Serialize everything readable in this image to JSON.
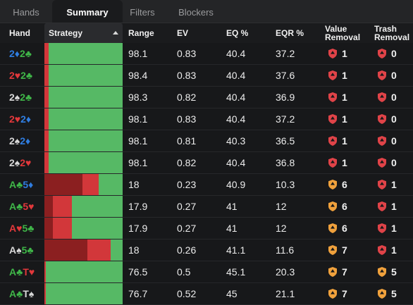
{
  "tabs": [
    "Hands",
    "Summary",
    "Filters",
    "Blockers"
  ],
  "active_tab": "Summary",
  "columns": {
    "hand": "Hand",
    "strategy": "Strategy",
    "range": "Range",
    "ev": "EV",
    "eq": "EQ %",
    "eqr": "EQR %",
    "value_removal": [
      "Value",
      "Removal"
    ],
    "trash_removal": [
      "Trash",
      "Removal"
    ]
  },
  "colors": {
    "dark_red": "#8b1f20",
    "red": "#d2373a",
    "green": "#56b965",
    "badge_red": "#e04348",
    "badge_orange": "#f0a13c"
  },
  "rows": [
    {
      "cards": [
        [
          "2",
          "diamond"
        ],
        [
          "2",
          "club"
        ]
      ],
      "strategy": [
        [
          "red",
          5
        ],
        [
          "green",
          95
        ]
      ],
      "range": "98.1",
      "ev": "0.83",
      "eq": "40.4",
      "eqr": "37.2",
      "value": "1",
      "value_badge": "red",
      "trash": "0",
      "trash_badge": "red"
    },
    {
      "cards": [
        [
          "2",
          "heart"
        ],
        [
          "2",
          "club"
        ]
      ],
      "strategy": [
        [
          "red",
          5
        ],
        [
          "green",
          95
        ]
      ],
      "range": "98.4",
      "ev": "0.83",
      "eq": "40.4",
      "eqr": "37.6",
      "value": "1",
      "value_badge": "red",
      "trash": "0",
      "trash_badge": "red"
    },
    {
      "cards": [
        [
          "2",
          "spade"
        ],
        [
          "2",
          "club"
        ]
      ],
      "strategy": [
        [
          "red",
          5
        ],
        [
          "green",
          95
        ]
      ],
      "range": "98.3",
      "ev": "0.82",
      "eq": "40.4",
      "eqr": "36.9",
      "value": "1",
      "value_badge": "red",
      "trash": "0",
      "trash_badge": "red"
    },
    {
      "cards": [
        [
          "2",
          "heart"
        ],
        [
          "2",
          "diamond"
        ]
      ],
      "strategy": [
        [
          "red",
          5
        ],
        [
          "green",
          95
        ]
      ],
      "range": "98.1",
      "ev": "0.83",
      "eq": "40.4",
      "eqr": "37.2",
      "value": "1",
      "value_badge": "red",
      "trash": "0",
      "trash_badge": "red"
    },
    {
      "cards": [
        [
          "2",
          "spade"
        ],
        [
          "2",
          "diamond"
        ]
      ],
      "strategy": [
        [
          "red",
          5
        ],
        [
          "green",
          95
        ]
      ],
      "range": "98.1",
      "ev": "0.81",
      "eq": "40.3",
      "eqr": "36.5",
      "value": "1",
      "value_badge": "red",
      "trash": "0",
      "trash_badge": "red"
    },
    {
      "cards": [
        [
          "2",
          "spade"
        ],
        [
          "2",
          "heart"
        ]
      ],
      "strategy": [
        [
          "red",
          5
        ],
        [
          "green",
          95
        ]
      ],
      "range": "98.1",
      "ev": "0.82",
      "eq": "40.4",
      "eqr": "36.8",
      "value": "1",
      "value_badge": "red",
      "trash": "0",
      "trash_badge": "red"
    },
    {
      "cards": [
        [
          "A",
          "club"
        ],
        [
          "5",
          "diamond"
        ]
      ],
      "strategy": [
        [
          "dark_red",
          49
        ],
        [
          "red",
          20
        ],
        [
          "green",
          31
        ]
      ],
      "range": "18",
      "ev": "0.23",
      "eq": "40.9",
      "eqr": "10.3",
      "value": "6",
      "value_badge": "orange",
      "trash": "1",
      "trash_badge": "red"
    },
    {
      "cards": [
        [
          "A",
          "club"
        ],
        [
          "5",
          "heart"
        ]
      ],
      "strategy": [
        [
          "dark_red",
          11
        ],
        [
          "red",
          24
        ],
        [
          "green",
          65
        ]
      ],
      "range": "17.9",
      "ev": "0.27",
      "eq": "41",
      "eqr": "12",
      "value": "6",
      "value_badge": "orange",
      "trash": "1",
      "trash_badge": "red"
    },
    {
      "cards": [
        [
          "A",
          "heart"
        ],
        [
          "5",
          "club"
        ]
      ],
      "strategy": [
        [
          "dark_red",
          11
        ],
        [
          "red",
          24
        ],
        [
          "green",
          65
        ]
      ],
      "range": "17.9",
      "ev": "0.27",
      "eq": "41",
      "eqr": "12",
      "value": "6",
      "value_badge": "orange",
      "trash": "1",
      "trash_badge": "red"
    },
    {
      "cards": [
        [
          "A",
          "spade"
        ],
        [
          "5",
          "club"
        ]
      ],
      "strategy": [
        [
          "dark_red",
          55
        ],
        [
          "red",
          30
        ],
        [
          "green",
          15
        ]
      ],
      "range": "18",
      "ev": "0.26",
      "eq": "41.1",
      "eqr": "11.6",
      "value": "7",
      "value_badge": "orange",
      "trash": "1",
      "trash_badge": "red"
    },
    {
      "cards": [
        [
          "A",
          "club"
        ],
        [
          "T",
          "heart"
        ]
      ],
      "strategy": [
        [
          "red",
          2
        ],
        [
          "green",
          98
        ]
      ],
      "range": "76.5",
      "ev": "0.5",
      "eq": "45.1",
      "eqr": "20.3",
      "value": "7",
      "value_badge": "orange",
      "trash": "5",
      "trash_badge": "orange"
    },
    {
      "cards": [
        [
          "A",
          "club"
        ],
        [
          "T",
          "spade"
        ]
      ],
      "strategy": [
        [
          "red",
          2
        ],
        [
          "green",
          98
        ]
      ],
      "range": "76.7",
      "ev": "0.52",
      "eq": "45",
      "eqr": "21.1",
      "value": "7",
      "value_badge": "orange",
      "trash": "5",
      "trash_badge": "orange"
    }
  ]
}
